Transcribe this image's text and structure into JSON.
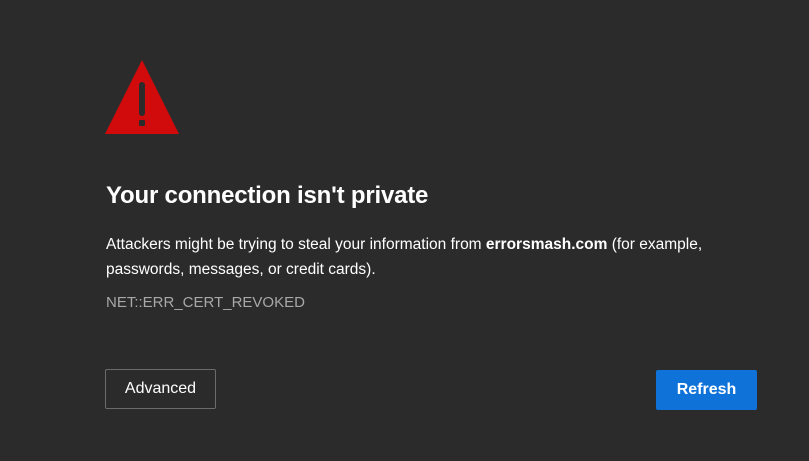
{
  "error": {
    "icon": "warning-triangle-icon",
    "icon_color": "#d10b0b",
    "title": "Your connection isn't private",
    "message_before": "Attackers might be trying to steal your information from ",
    "domain": "errorsmash.com",
    "message_after": " (for example, passwords, messages, or credit cards).",
    "code": "NET::ERR_CERT_REVOKED"
  },
  "actions": {
    "advanced_label": "Advanced",
    "refresh_label": "Refresh",
    "refresh_color": "#0f72d8"
  },
  "theme": {
    "background": "#2b2b2b"
  }
}
